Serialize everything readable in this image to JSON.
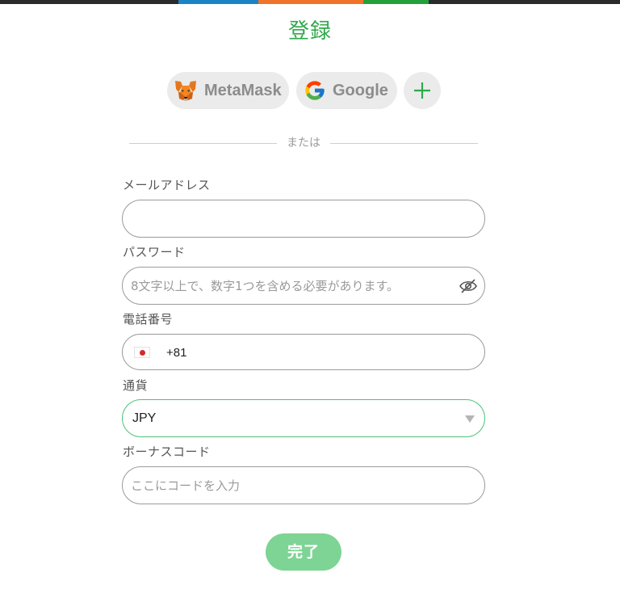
{
  "title": "登録",
  "social": {
    "metamask_label": "MetaMask",
    "google_label": "Google",
    "more_icon": "plus-icon"
  },
  "divider_text": "または",
  "email": {
    "label": "メールアドレス",
    "value": "",
    "placeholder": ""
  },
  "password": {
    "label": "パスワード",
    "placeholder": "8文字以上で、数字1つを含める必要があります。",
    "icon": "eye-off-icon"
  },
  "phone": {
    "label": "電話番号",
    "flag": "japan-flag-icon",
    "code": "+81"
  },
  "currency": {
    "label": "通貨",
    "selected": "JPY"
  },
  "bonus": {
    "label": "ボーナスコード",
    "placeholder": "ここにコードを入力"
  },
  "submit_label": "完了",
  "colors": {
    "accent": "#2ea94a",
    "submit_bg": "#7ed494",
    "active_border": "#4cc17a",
    "top_blue": "#1a84c4",
    "top_orange": "#f0732a",
    "top_green": "#24a03b"
  }
}
